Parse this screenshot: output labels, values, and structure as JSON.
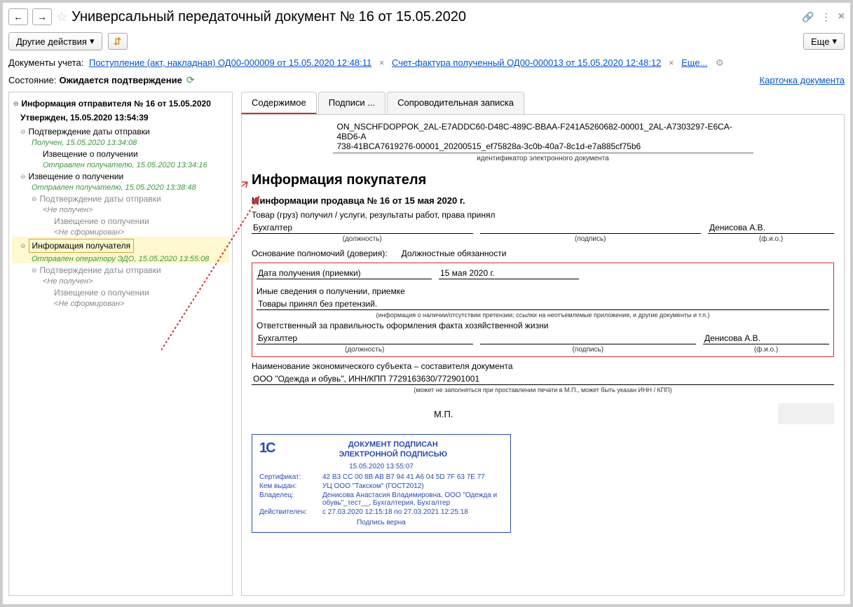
{
  "header": {
    "title": "Универсальный передаточный документ № 16 от 15.05.2020"
  },
  "toolbar": {
    "other_actions": "Другие действия",
    "more": "Еще"
  },
  "docs": {
    "label": "Документы учета:",
    "link1": "Поступление (акт, накладная) ОД00-000009 от 15.05.2020 12:48:11",
    "link2": "Счет-фактура полученный ОД00-000013 от 15.05.2020 12:48:12",
    "more": "Еще..."
  },
  "status": {
    "label": "Состояние:",
    "value": "Ожидается подтверждение",
    "card_link": "Карточка документа"
  },
  "tree": {
    "root": "Информация отправителя № 16 от 15.05.2020",
    "root_status": "Утвержден, 15.05.2020 13:54:39",
    "n1": "Подтверждение даты отправки",
    "n1_status": "Получен, 15.05.2020 13:34:08",
    "n1_1": "Извещение о получении",
    "n1_1_status": "Отправлен получателю, 15.05.2020 13:34:16",
    "n2": "Извещение о получении",
    "n2_status": "Отправлен получателю, 15.05.2020 13:38:48",
    "n2_1": "Подтверждение даты отправки",
    "n2_1_status": "<Не получен>",
    "n2_1_1": "Извещение о получении",
    "n2_1_1_status": "<Не сформирован>",
    "n3": "Информация получателя",
    "n3_status": "Отправлен оператору ЭДО, 15.05.2020 13:55:08",
    "n3_1": "Подтверждение даты отправки",
    "n3_1_status": "<Не получен>",
    "n3_1_1": "Извещение о получении",
    "n3_1_1_status": "<Не сформирован>"
  },
  "tabs": {
    "t1": "Содержимое",
    "t2": "Подписи ...",
    "t3": "Сопроводительная записка"
  },
  "doc": {
    "id_line1": "ON_NSCHFDOPPOK_2AL-E7ADDC60-D48C-489C-BBAA-F241A5260682-00001_2AL-A7303297-E6CA-4BD6-A",
    "id_line2": "738-41BCA7619276-00001_20200515_ef75828a-3c0b-40a7-8c1d-e7a885cf75b6",
    "id_caption": "идентификатор электронного документа",
    "buyer_title": "Информация покупателя",
    "seller_ref": "К информации продавца № 16 от 15 мая 2020 г.",
    "receipt_line": "Товар (груз) получил / услуги, результаты работ, права принял",
    "position1": "Бухгалтер",
    "fio1": "Денисова А.В.",
    "cap_position": "(должность)",
    "cap_signature": "(подпись)",
    "cap_fio": "(ф.и.о.)",
    "grounds_label": "Основание полномочий (доверия):",
    "grounds_value": "Должностные обязанности",
    "receive_date_label": "Дата получения (приемки)",
    "receive_date_value": "15 мая 2020 г.",
    "other_info_label": "Иные сведения о получении, приемке",
    "other_info_value": "Товары принял без претензий.",
    "hint1": "(информация о наличии/отсутствии претензии; ссылки на неотъемлемые приложения, и другие  документы и т.п.)",
    "responsible": "Ответственный за правильность оформления факта хозяйственной жизни",
    "position2": "Бухгалтер",
    "fio2": "Денисова А.В.",
    "entity_label": "Наименование экономического субъекта – составителя документа",
    "entity_value": "ООО \"Одежда и обувь\", ИНН/КПП 7729163630/772901001",
    "hint2": "(может не заполняться при проставлении печати в М.П., может быть указан ИНН / КПП)",
    "mp": "М.П."
  },
  "stamp": {
    "h1": "ДОКУМЕНТ ПОДПИСАН",
    "h2": "ЭЛЕКТРОННОЙ ПОДПИСЬЮ",
    "date": "15.05.2020 13:55:07",
    "cert_label": "Сертификат:",
    "cert_value": "42 B3 CC 00 8B AB B7 94 41 A6 04 5D 7F 63 7E 77",
    "issued_label": "Кем выдан:",
    "issued_value": "УЦ ООО \"Такском\" (ГОСТ2012)",
    "owner_label": "Владелец:",
    "owner_value": "Денисова Анастасия Владимировна, ООО \"Одежда и обувь\"_тест__, Бухгалтерия, Бухгалтер",
    "valid_label": "Действителен:",
    "valid_value": "с 27.03.2020 12:15:18 по 27.03.2021 12:25:18",
    "valid_text": "Подпись верна"
  }
}
